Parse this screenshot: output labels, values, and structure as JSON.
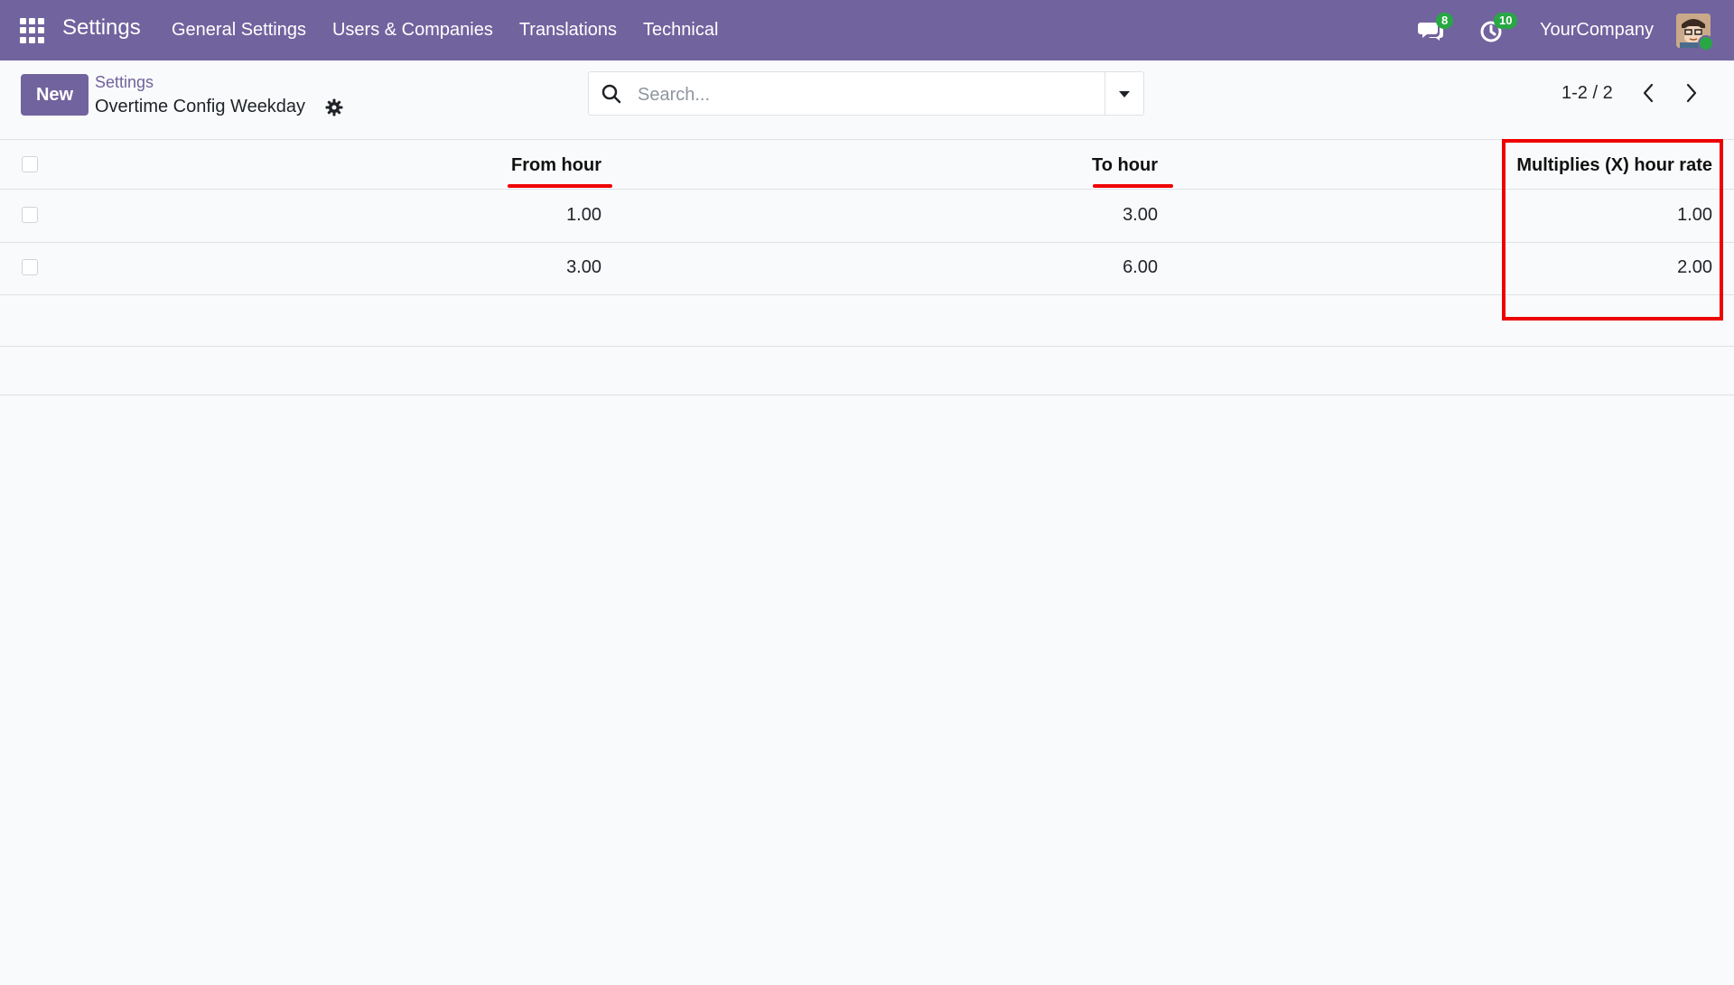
{
  "navbar": {
    "app_name": "Settings",
    "menu": [
      "General Settings",
      "Users & Companies",
      "Translations",
      "Technical"
    ],
    "messages_badge": "8",
    "activities_badge": "10",
    "company": "YourCompany"
  },
  "control_panel": {
    "new_label": "New",
    "breadcrumb_parent": "Settings",
    "breadcrumb_current": "Overtime Config Weekday",
    "search_placeholder": "Search...",
    "pager": "1-2 / 2"
  },
  "table": {
    "columns": [
      "From hour",
      "To hour",
      "Multiplies (X) hour rate"
    ],
    "rows": [
      [
        "1.00",
        "3.00",
        "1.00"
      ],
      [
        "3.00",
        "6.00",
        "2.00"
      ]
    ]
  },
  "annotations": {
    "color": "#e00000"
  }
}
